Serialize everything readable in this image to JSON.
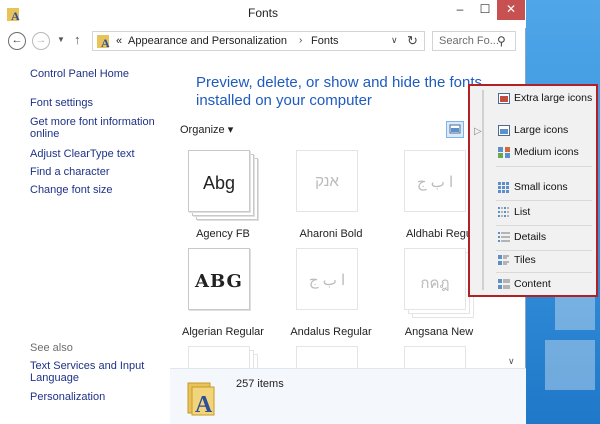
{
  "window": {
    "title": "Fonts"
  },
  "titlebar": {
    "minimize": "‒",
    "maximize": "☐",
    "close": "✕"
  },
  "address": {
    "prefix": "«",
    "crumbs": [
      "Appearance and Personalization",
      "Fonts"
    ],
    "separator": "›",
    "search_placeholder": "Search Fo..."
  },
  "sidebar": {
    "home": "Control Panel Home",
    "links": [
      "Font settings",
      "Get more font information online",
      "Adjust ClearType text",
      "Find a character",
      "Change font size"
    ],
    "see_also_label": "See also",
    "see_also": [
      "Text Services and Input Language",
      "Personalization"
    ]
  },
  "main": {
    "heading": "Preview, delete, or show and hide the fonts installed on your computer",
    "organize_label": "Organize ▾",
    "fonts": [
      {
        "name": "Agency FB",
        "sample": "Abg",
        "family": false
      },
      {
        "name": "Aharoni Bold",
        "sample": "אנק",
        "hidden": true
      },
      {
        "name": "Aldhabi Regu",
        "sample": "ﺍ ﺏ ﺝ",
        "hidden": true
      },
      {
        "name": "Algerian Regular",
        "sample": "ABG"
      },
      {
        "name": "Andalus Regular",
        "sample": "ﺍ ﺏ ﺝ",
        "hidden": true
      },
      {
        "name": "Angsana New",
        "sample": "กคฎ",
        "hidden": true
      }
    ],
    "status": "257 items"
  },
  "view_menu": {
    "items": [
      {
        "label": "Extra large icons",
        "icon": "extra-large-icons-icon"
      },
      {
        "label": "Large icons",
        "icon": "large-icons-icon"
      },
      {
        "label": "Medium icons",
        "icon": "medium-icons-icon"
      },
      {
        "label": "Small icons",
        "icon": "small-icons-icon"
      },
      {
        "label": "List",
        "icon": "list-icon"
      },
      {
        "label": "Details",
        "icon": "details-icon"
      },
      {
        "label": "Tiles",
        "icon": "tiles-icon"
      },
      {
        "label": "Content",
        "icon": "content-icon"
      }
    ],
    "highlight_color": "#b21f24"
  },
  "colors": {
    "link": "#1e3287",
    "heading": "#1e5bbf",
    "close": "#c75050"
  }
}
